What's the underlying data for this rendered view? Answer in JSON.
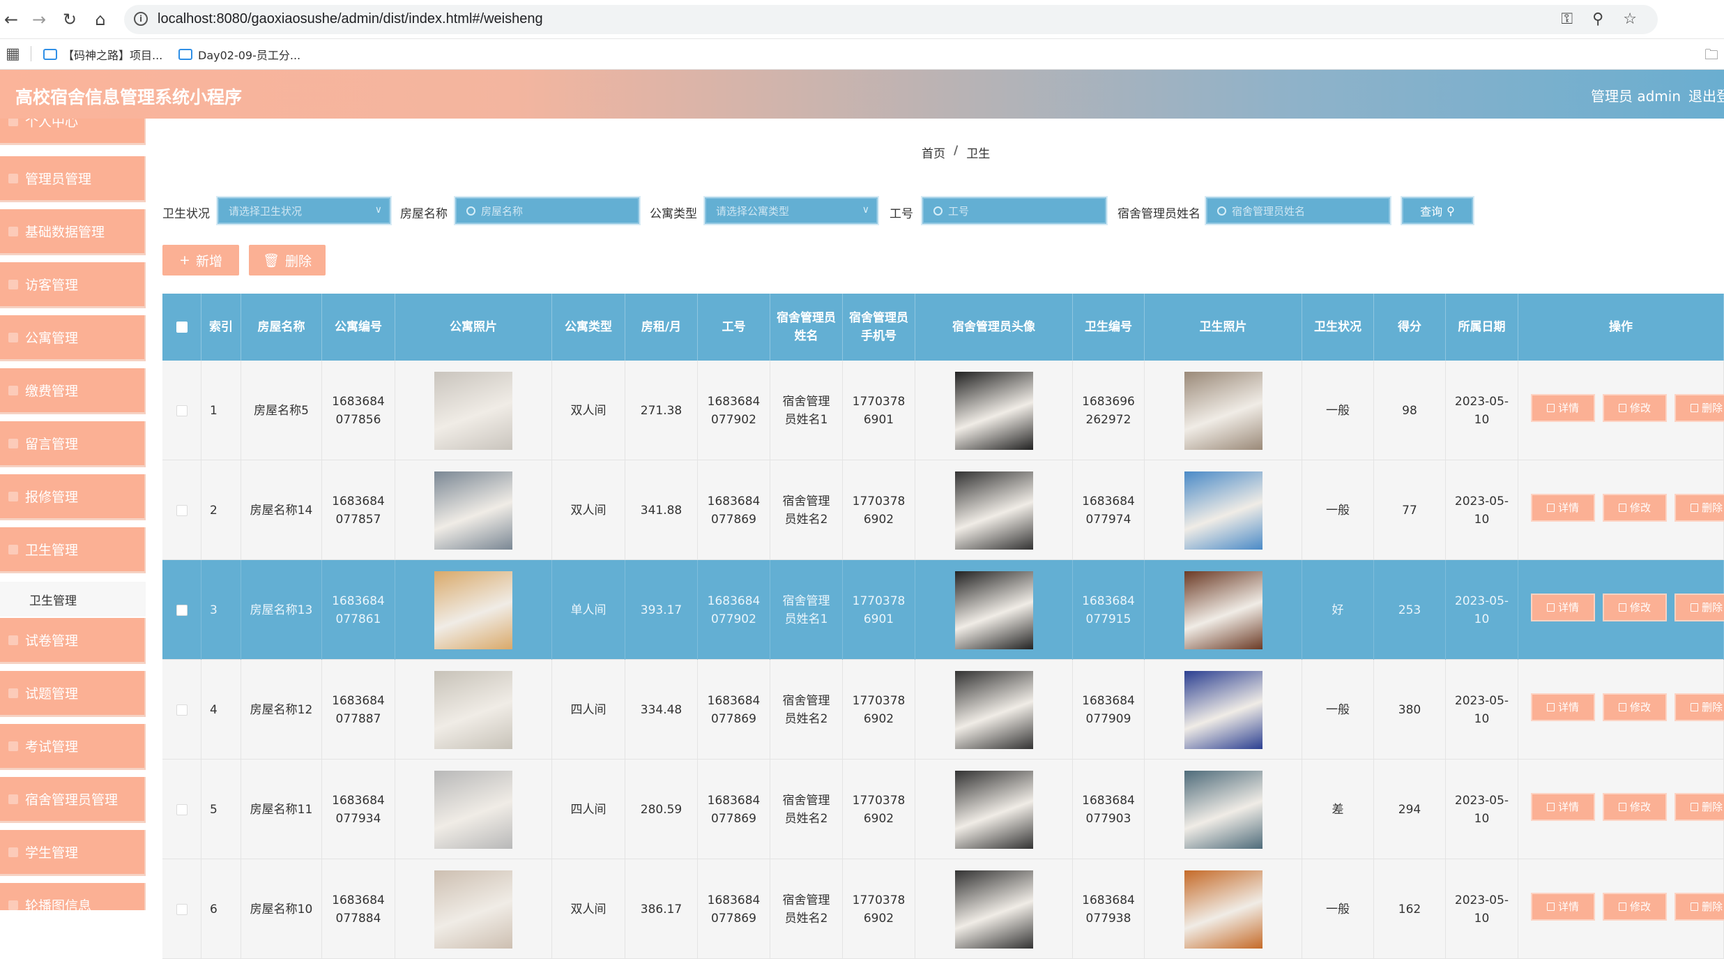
{
  "browser": {
    "url": "localhost:8080/gaoxiaosushe/admin/dist/index.html#/weisheng",
    "bookmarks": [
      "【码神之路】项目...",
      "Day02-09-员工分..."
    ]
  },
  "header": {
    "title": "高校宿舍信息管理系统小程序",
    "user": "管理员 admin",
    "logout": "退出登"
  },
  "sidebar": {
    "items": [
      "个人中心",
      "管理员管理",
      "基础数据管理",
      "访客管理",
      "公寓管理",
      "缴费管理",
      "留言管理",
      "报修管理",
      "卫生管理",
      "试卷管理",
      "试题管理",
      "考试管理",
      "宿舍管理员管理",
      "学生管理",
      "轮播图信息"
    ],
    "active_sub": "卫生管理"
  },
  "breadcrumb": {
    "home": "首页",
    "sep": "/",
    "current": "卫生"
  },
  "filters": {
    "status_label": "卫生状况",
    "status_placeholder": "请选择卫生状况",
    "room_label": "房屋名称",
    "room_placeholder": "房屋名称",
    "type_label": "公寓类型",
    "type_placeholder": "请选择公寓类型",
    "id_label": "工号",
    "id_placeholder": "工号",
    "mgr_label": "宿舍管理员姓名",
    "mgr_placeholder": "宿舍管理员姓名",
    "query": "查询"
  },
  "actions": {
    "add": "新增",
    "delete": "删除"
  },
  "table": {
    "headers": [
      "索引",
      "房屋名称",
      "公寓编号",
      "公寓照片",
      "公寓类型",
      "房租/月",
      "工号",
      "宿舍管理员姓名",
      "宿舍管理员手机号",
      "宿舍管理员头像",
      "卫生编号",
      "卫生照片",
      "卫生状况",
      "得分",
      "所属日期",
      "操作"
    ],
    "op_labels": {
      "detail": "详情",
      "edit": "修改",
      "delete": "删除"
    },
    "rows": [
      {
        "idx": "1",
        "room": "房屋名称5",
        "apt_no": "1683684077856",
        "type": "双人间",
        "rent": "271.38",
        "worker_id": "1683684077902",
        "mgr": "宿舍管理员姓名1",
        "phone": "17703786901",
        "hyg_no": "1683696262972",
        "status": "一般",
        "score": "98",
        "date": "2023-05-10",
        "selected": false
      },
      {
        "idx": "2",
        "room": "房屋名称14",
        "apt_no": "1683684077857",
        "type": "双人间",
        "rent": "341.88",
        "worker_id": "1683684077869",
        "mgr": "宿舍管理员姓名2",
        "phone": "17703786902",
        "hyg_no": "1683684077974",
        "status": "一般",
        "score": "77",
        "date": "2023-05-10",
        "selected": false
      },
      {
        "idx": "3",
        "room": "房屋名称13",
        "apt_no": "1683684077861",
        "type": "单人间",
        "rent": "393.17",
        "worker_id": "1683684077902",
        "mgr": "宿舍管理员姓名1",
        "phone": "17703786901",
        "hyg_no": "1683684077915",
        "status": "好",
        "score": "253",
        "date": "2023-05-10",
        "selected": true
      },
      {
        "idx": "4",
        "room": "房屋名称12",
        "apt_no": "1683684077887",
        "type": "四人间",
        "rent": "334.48",
        "worker_id": "1683684077869",
        "mgr": "宿舍管理员姓名2",
        "phone": "17703786902",
        "hyg_no": "1683684077909",
        "status": "一般",
        "score": "380",
        "date": "2023-05-10",
        "selected": false
      },
      {
        "idx": "5",
        "room": "房屋名称11",
        "apt_no": "1683684077934",
        "type": "四人间",
        "rent": "280.59",
        "worker_id": "1683684077869",
        "mgr": "宿舍管理员姓名2",
        "phone": "17703786902",
        "hyg_no": "1683684077903",
        "status": "差",
        "score": "294",
        "date": "2023-05-10",
        "selected": false
      },
      {
        "idx": "6",
        "room": "房屋名称10",
        "apt_no": "1683684077884",
        "type": "双人间",
        "rent": "386.17",
        "worker_id": "1683684077869",
        "mgr": "宿舍管理员姓名2",
        "phone": "17703786902",
        "hyg_no": "1683684077938",
        "status": "一般",
        "score": "162",
        "date": "2023-05-10",
        "selected": false
      }
    ]
  },
  "colors": {
    "accent_blue": "#63afd3",
    "accent_salmon": "#fbb094"
  }
}
